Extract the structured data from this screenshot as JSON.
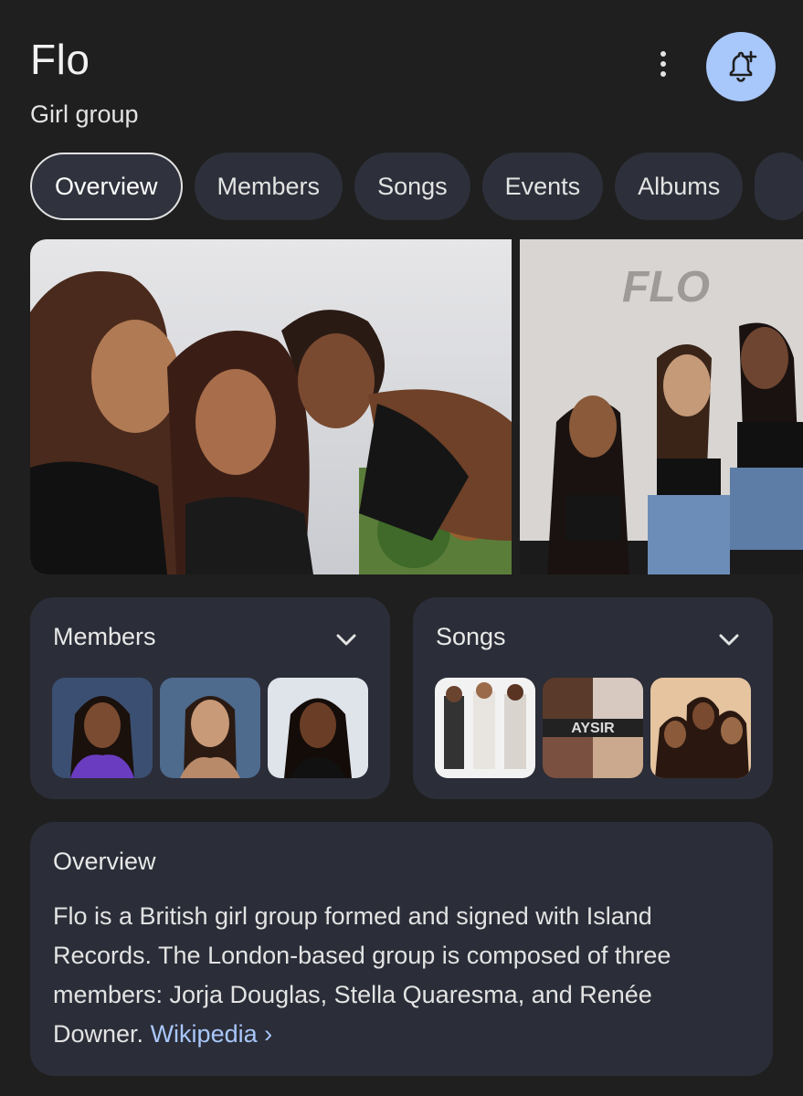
{
  "header": {
    "title": "Flo",
    "subtitle": "Girl group"
  },
  "tabs": [
    "Overview",
    "Members",
    "Songs",
    "Events",
    "Albums"
  ],
  "active_tab": "Overview",
  "images": {
    "photo_2_logo_text": "FLO"
  },
  "members_card": {
    "title": "Members"
  },
  "songs_card": {
    "title": "Songs"
  },
  "overview_card": {
    "title": "Overview",
    "text": "Flo is a British girl group formed and signed with Island Records. The London-based group is composed of three members: Jorja Douglas, Stella Quaresma, and Renée Downer.",
    "link_label": "Wikipedia ›"
  },
  "colors": {
    "background": "#1f1f1f",
    "card": "#2b2d38",
    "accent": "#a8c7fa"
  }
}
